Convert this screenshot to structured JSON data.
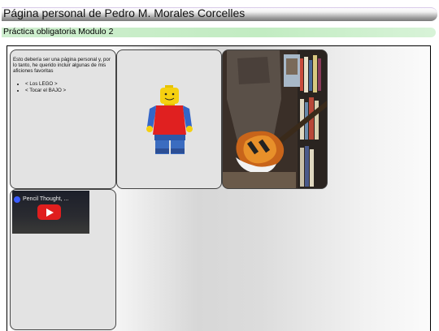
{
  "header": {
    "title": "Página personal de Pedro M. Morales Corcelles",
    "subtitle": "Práctica obligatoria Modulo 2"
  },
  "intro": {
    "text": "Esto debería ser una página personal y, por lo tanto, he querido incluir algunas de mis aficiones favoritas",
    "links": [
      "< Los LEGO >",
      "< Tocar el BAJO >"
    ]
  },
  "video": {
    "title": "Pencil Thought, ..."
  },
  "colors": {
    "title_bar": "#7a7a7a",
    "subtitle_bar": "#c2ecc2",
    "play_button": "#e01e1e"
  }
}
